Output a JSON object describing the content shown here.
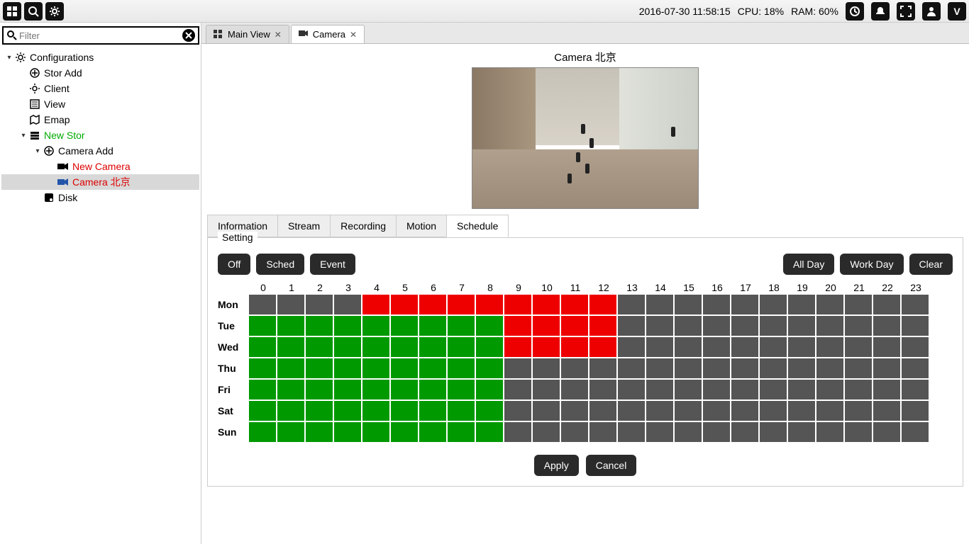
{
  "topbar": {
    "datetime": "2016-07-30 11:58:15",
    "cpu_label": "CPU: 18%",
    "ram_label": "RAM: 60%"
  },
  "filter": {
    "placeholder": "Filter"
  },
  "tree": {
    "root": "Configurations",
    "stor_add": "Stor Add",
    "client": "Client",
    "view": "View",
    "emap": "Emap",
    "new_stor": "New Stor",
    "camera_add": "Camera Add",
    "new_camera": "New Camera",
    "camera_beijing": "Camera 北京",
    "disk": "Disk"
  },
  "tabs": {
    "main_view": "Main View",
    "camera": "Camera"
  },
  "camera_title": "Camera 北京",
  "subtabs": {
    "information": "Information",
    "stream": "Stream",
    "recording": "Recording",
    "motion": "Motion",
    "schedule": "Schedule"
  },
  "schedule": {
    "fieldset": "Setting",
    "btn_off": "Off",
    "btn_sched": "Sched",
    "btn_event": "Event",
    "btn_allday": "All Day",
    "btn_workday": "Work Day",
    "btn_clear": "Clear",
    "hours": [
      "0",
      "1",
      "2",
      "3",
      "4",
      "5",
      "6",
      "7",
      "8",
      "9",
      "10",
      "11",
      "12",
      "13",
      "14",
      "15",
      "16",
      "17",
      "18",
      "19",
      "20",
      "21",
      "22",
      "23"
    ],
    "days": [
      "Mon",
      "Tue",
      "Wed",
      "Thu",
      "Fri",
      "Sat",
      "Sun"
    ],
    "grid": [
      [
        "off",
        "off",
        "off",
        "off",
        "red",
        "red",
        "red",
        "red",
        "red",
        "red",
        "red",
        "red",
        "red",
        "off",
        "off",
        "off",
        "off",
        "off",
        "off",
        "off",
        "off",
        "off",
        "off",
        "off"
      ],
      [
        "green",
        "green",
        "green",
        "green",
        "green",
        "green",
        "green",
        "green",
        "green",
        "red",
        "red",
        "red",
        "red",
        "off",
        "off",
        "off",
        "off",
        "off",
        "off",
        "off",
        "off",
        "off",
        "off",
        "off"
      ],
      [
        "green",
        "green",
        "green",
        "green",
        "green",
        "green",
        "green",
        "green",
        "green",
        "red",
        "red",
        "red",
        "red",
        "off",
        "off",
        "off",
        "off",
        "off",
        "off",
        "off",
        "off",
        "off",
        "off",
        "off"
      ],
      [
        "green",
        "green",
        "green",
        "green",
        "green",
        "green",
        "green",
        "green",
        "green",
        "off",
        "off",
        "off",
        "off",
        "off",
        "off",
        "off",
        "off",
        "off",
        "off",
        "off",
        "off",
        "off",
        "off",
        "off"
      ],
      [
        "green",
        "green",
        "green",
        "green",
        "green",
        "green",
        "green",
        "green",
        "green",
        "off",
        "off",
        "off",
        "off",
        "off",
        "off",
        "off",
        "off",
        "off",
        "off",
        "off",
        "off",
        "off",
        "off",
        "off"
      ],
      [
        "green",
        "green",
        "green",
        "green",
        "green",
        "green",
        "green",
        "green",
        "green",
        "off",
        "off",
        "off",
        "off",
        "off",
        "off",
        "off",
        "off",
        "off",
        "off",
        "off",
        "off",
        "off",
        "off",
        "off"
      ],
      [
        "green",
        "green",
        "green",
        "green",
        "green",
        "green",
        "green",
        "green",
        "green",
        "off",
        "off",
        "off",
        "off",
        "off",
        "off",
        "off",
        "off",
        "off",
        "off",
        "off",
        "off",
        "off",
        "off",
        "off"
      ]
    ],
    "btn_apply": "Apply",
    "btn_cancel": "Cancel"
  }
}
